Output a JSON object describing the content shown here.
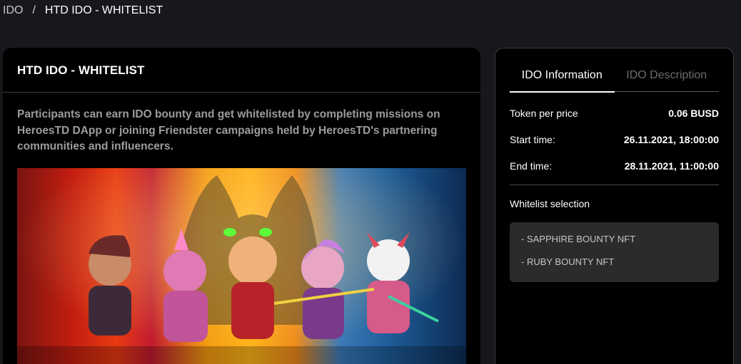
{
  "breadcrumb": {
    "root": "IDO",
    "separator": "/",
    "current": "HTD IDO - WHITELIST"
  },
  "main": {
    "title": "HTD IDO - WHITELIST",
    "description": "Participants can earn IDO bounty and get whitelisted by completing missions on HeroesTD DApp or joining Friendster campaigns held by HeroesTD's partnering communities and influencers."
  },
  "side": {
    "tabs": [
      {
        "label": "IDO Information",
        "active": true
      },
      {
        "label": "IDO Description",
        "active": false
      }
    ],
    "info": [
      {
        "label": "Token per price",
        "value": "0.06 BUSD"
      },
      {
        "label": "Start time:",
        "value": "26.11.2021, 18:00:00"
      },
      {
        "label": "End time:",
        "value": "28.11.2021, 11:00:00"
      }
    ],
    "whitelist_title": "Whitelist selection",
    "whitelist_items": [
      "- SAPPHIRE BOUNTY NFT",
      "- RUBY BOUNTY NFT"
    ]
  },
  "colors": {
    "background": "#18181c",
    "card": "#000000",
    "muted_text": "#9c9c9c",
    "box": "#2b2b2d"
  }
}
